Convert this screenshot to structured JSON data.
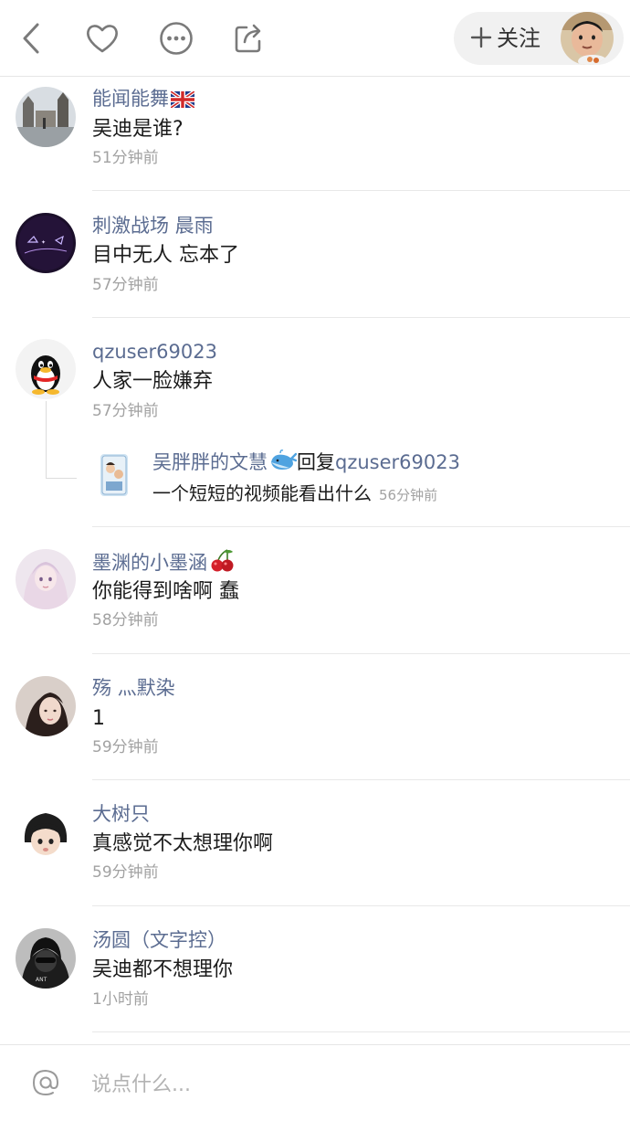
{
  "header": {
    "back_icon": "back-chevron-icon",
    "like_icon": "heart-icon",
    "more_icon": "more-dots-icon",
    "share_icon": "share-icon",
    "follow_label": "关注"
  },
  "comments": [
    {
      "name": "能闻能舞",
      "badge": "uk-flag-icon",
      "text": "吴迪是谁?",
      "time": "51分钟前"
    },
    {
      "name": "刺激战场 晨雨",
      "text": "目中无人 忘本了",
      "time": "57分钟前"
    },
    {
      "name": "qzuser69023",
      "text": "人家一脸嫌弃",
      "time": "57分钟前",
      "reply": {
        "name": "吴胖胖的文慧",
        "badge": "whale-emoji",
        "reply_word": "回复",
        "target": "qzuser69023",
        "text": "一个短短的视频能看出什么",
        "time": "56分钟前"
      }
    },
    {
      "name": "墨渊的小墨涵",
      "badge": "cherry-emoji",
      "text": "你能得到啥啊 蠢",
      "time": "58分钟前"
    },
    {
      "name": "殇 灬默染",
      "text": "1",
      "time": "59分钟前"
    },
    {
      "name": "大树只",
      "text": "真感觉不太想理你啊",
      "time": "59分钟前"
    },
    {
      "name": "汤圆（文字控）",
      "text": "吴迪都不想理你",
      "time": "1小时前"
    }
  ],
  "input": {
    "placeholder": "说点什么..."
  }
}
